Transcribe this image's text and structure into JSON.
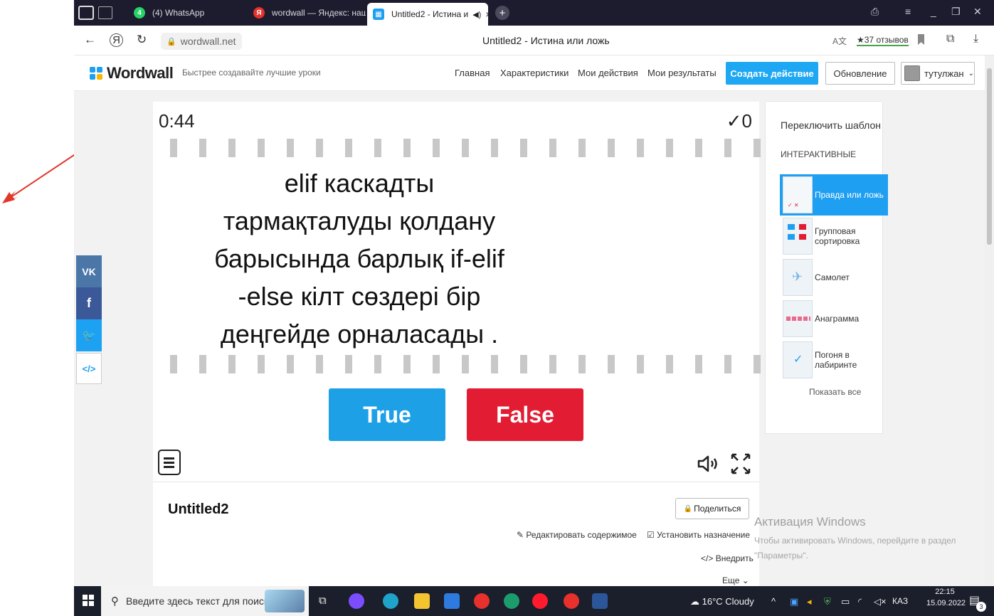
{
  "browser": {
    "tabs": [
      {
        "label": "(4) WhatsApp",
        "color": "#25d366"
      },
      {
        "label": "wordwall — Яндекс: нашлось",
        "color": "#e8302c"
      },
      {
        "label": "Untitled2 - Истина и",
        "color": "#1e9ff2"
      }
    ],
    "url": "wordwall.net",
    "page_title": "Untitled2 - Истина или ложь",
    "reviews": "★37 отзывов"
  },
  "header": {
    "logo": "Wordwall",
    "tagline": "Быстрее создавайте лучшие уроки",
    "nav": [
      "Главная",
      "Характеристики",
      "Мои действия",
      "Мои результаты"
    ],
    "create_label": "Создать действие",
    "upgrade_label": "Обновление",
    "user_name": "тутулжан"
  },
  "game": {
    "timer": "0:44",
    "score": "✓0",
    "question": "elif каскадты\nтармақталуды  қолдану\nбарысында  барлық  if-elif\n-else кілт  сөздері  бір\nдеңгейде  орналасады .",
    "true_label": "True",
    "false_label": "False",
    "true_color": "#1ea0e6",
    "false_color": "#e21d33"
  },
  "activity": {
    "title": "Untitled2",
    "share_label": "Поделиться",
    "edit_label": "Редактировать содержимое",
    "assign_label": "Установить назначение",
    "embed_label": "Внедрить",
    "more_label": "Еще"
  },
  "sidebar": {
    "switch_label": "Переключить шаблон",
    "section_label": "ИНТЕРАКТИВНЫЕ",
    "templates": [
      "Правда или ложь",
      "Групповая сортировка",
      "Самолет",
      "Анаграмма",
      "Погоня в лабиринте"
    ],
    "show_all": "Показать все"
  },
  "social": {
    "vk": "VK",
    "fb": "f",
    "embed": "</>"
  },
  "watermark": {
    "title": "Активация Windows",
    "text": "Чтобы активировать Windows, перейдите в раздел \"Параметры\"."
  },
  "taskbar": {
    "search_placeholder": "Введите здесь текст для поиска",
    "weather": "16°C  Cloudy",
    "lang": "КАЗ",
    "time": "22:15",
    "date": "15.09.2022",
    "notif": "3"
  }
}
